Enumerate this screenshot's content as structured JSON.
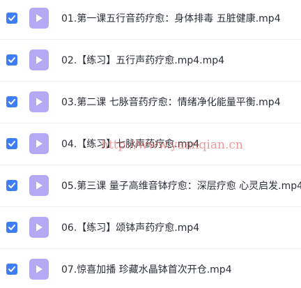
{
  "colors": {
    "checkbox": "#3f7df5",
    "video_icon": "#b6a9f3",
    "text": "#2b2f38",
    "divider": "#eef0f4",
    "watermark": "#dc4646"
  },
  "icons": {
    "checkbox": "check-icon",
    "file": "play-icon"
  },
  "files": [
    {
      "name": "01.第一课五行音药疗愈：身体排毒 五脏健康.mp4",
      "checked": true
    },
    {
      "name": "02.【练习】五行声药疗愈.mp4.mp4",
      "checked": true
    },
    {
      "name": "03.第二课 七脉音药疗愈：情绪净化能量平衡.mp4",
      "checked": true
    },
    {
      "name": "04.【练习】七脉声药疗愈.mp4",
      "checked": true
    },
    {
      "name": "05.第三课 量子高维音钵疗愈：深层疗愈 心灵启发.mp4",
      "checked": true
    },
    {
      "name": "06.【练习】颂钵声药疗愈.mp4",
      "checked": true
    },
    {
      "name": "07.惊喜加播 珍藏水晶钵首次开仓.mp4",
      "checked": true
    }
  ],
  "watermark": "http://www.yaanqian.cn"
}
